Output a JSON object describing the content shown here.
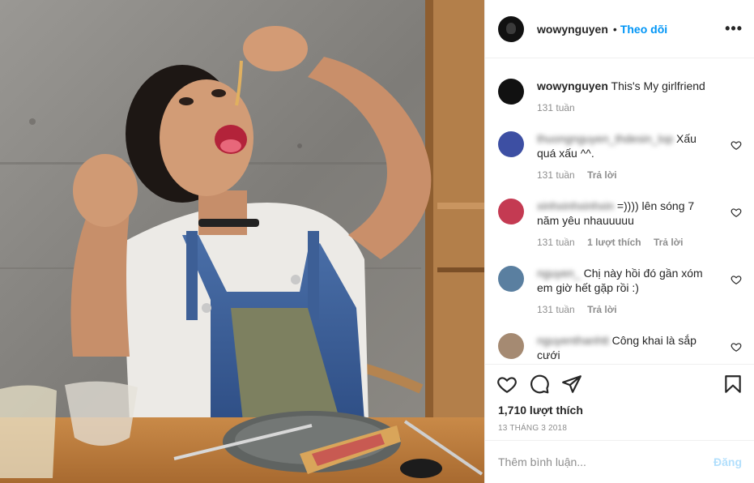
{
  "header": {
    "username": "wowynguyen",
    "dot": "•",
    "follow_label": "Theo dõi",
    "more_icon": "more-horizontal-icon"
  },
  "caption": {
    "username": "wowynguyen",
    "text": "This's My girlfriend",
    "time": "131 tuần"
  },
  "comments": [
    {
      "username": "thuongnguyen_thdesin_lop",
      "text": "Xấu quá xấu ^^.",
      "time": "131 tuần",
      "reply_label": "Trả lời",
      "likes": "",
      "avatar_color": "#3d4fa3"
    },
    {
      "username": "xinhxinhxinhxin",
      "text": "=)))) lên sóng 7 năm yêu nhauuuuu",
      "time": "131 tuần",
      "reply_label": "Trả lời",
      "likes": "1 lượt thích",
      "avatar_color": "#c43a52"
    },
    {
      "username": "nguyen_",
      "text": "Chị này hồi đó gần xóm em giờ hết gặp rồi :)",
      "time": "131 tuần",
      "reply_label": "Trả lời",
      "likes": "",
      "avatar_color": "#5a7fa0"
    },
    {
      "username": "nguyenthanhtt",
      "text": "Công khai là sắp cưới",
      "time": "",
      "reply_label": "",
      "likes": "",
      "avatar_color": "#a58a72"
    }
  ],
  "actions": {
    "like_icon": "heart-outline-icon",
    "comment_icon": "comment-bubble-icon",
    "share_icon": "paper-plane-icon",
    "save_icon": "bookmark-icon",
    "likes_count": "1,710 lượt thích",
    "date": "13 THÁNG 3 2018"
  },
  "add_comment": {
    "placeholder": "Thêm bình luận...",
    "post_label": "Đăng",
    "post_color": "#b2dffc"
  },
  "colors": {
    "accent": "#0095f6",
    "muted": "#8e8e8e",
    "text": "#262626"
  }
}
